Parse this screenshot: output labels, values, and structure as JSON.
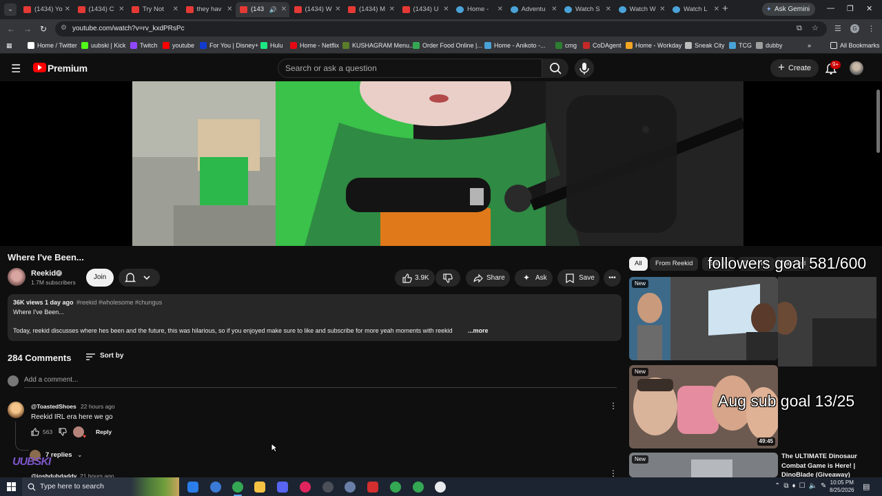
{
  "browser": {
    "tabs": [
      {
        "label": "(1434) Yo",
        "icon": "youtube-icon"
      },
      {
        "label": "(1434) C",
        "icon": "youtube-icon"
      },
      {
        "label": "Try Not",
        "icon": "youtube-icon"
      },
      {
        "label": "they hav",
        "icon": "youtube-icon"
      },
      {
        "label": "(143",
        "icon": "youtube-icon",
        "active": true
      },
      {
        "label": "(1434) W",
        "icon": "youtube-icon"
      },
      {
        "label": "(1434) M",
        "icon": "youtube-icon"
      },
      {
        "label": "(1434) U",
        "icon": "youtube-icon"
      },
      {
        "label": "Home -",
        "icon": "globe-icon"
      },
      {
        "label": "Adventu",
        "icon": "globe-icon"
      },
      {
        "label": "Watch S",
        "icon": "globe-icon"
      },
      {
        "label": "Watch W",
        "icon": "globe-icon"
      },
      {
        "label": "Watch L",
        "icon": "globe-icon"
      }
    ],
    "ask_gemini": "Ask Gemini",
    "url": "youtube.com/watch?v=rv_kxdPRsPc",
    "bookmarks": [
      {
        "label": "Home / Twitter",
        "color": "#ffffff"
      },
      {
        "label": "uubski | Kick",
        "color": "#53fc18"
      },
      {
        "label": "Twitch",
        "color": "#9146ff"
      },
      {
        "label": "youtube",
        "color": "#ff0000"
      },
      {
        "label": "For You | Disney+",
        "color": "#113ccf"
      },
      {
        "label": "Hulu",
        "color": "#1ce783"
      },
      {
        "label": "Home - Netflix",
        "color": "#e50914"
      },
      {
        "label": "KUSHAGRAM Menu...",
        "color": "#5a7d2a"
      },
      {
        "label": "Order Food Online |...",
        "color": "#34a853"
      },
      {
        "label": "Home - Anikoto -...",
        "color": "#4aa3d8"
      },
      {
        "label": "cmg",
        "color": "#2e7d32"
      },
      {
        "label": "CoDAgent",
        "color": "#c62828"
      },
      {
        "label": "Home - Workday",
        "color": "#f5a623"
      },
      {
        "label": "Sneak City",
        "color": "#bdbdbd"
      },
      {
        "label": "TCG",
        "color": "#4aa3d8"
      },
      {
        "label": "dubby",
        "color": "#9e9e9e"
      }
    ],
    "all_bookmarks": "All Bookmarks"
  },
  "youtube": {
    "brand": "Premium",
    "search_placeholder": "Search or ask a question",
    "create_label": "Create",
    "notif_badge": "9+"
  },
  "video": {
    "title": "Where I've Been...",
    "channel": "Reekid",
    "subscribers": "1.7M subscribers",
    "join_label": "Join",
    "likes": "3.9K",
    "share_label": "Share",
    "ask_label": "Ask",
    "save_label": "Save",
    "description": {
      "meta": "36K views  1 day ago",
      "tags": "#reekid #wholesome #chungus",
      "line1": "Where I've Been...",
      "line2": "Today, reekid discusses where hes been and the future, this was hilarious, so if you enjoyed make sure to like and subscribe for more yeah moments with reekid",
      "more": "...more"
    }
  },
  "comments": {
    "count_label": "284 Comments",
    "sort_label": "Sort by",
    "add_placeholder": "Add a comment...",
    "items": [
      {
        "author": "@ToastedShoes",
        "time": "22 hours ago",
        "text": "Reekid IRL era here we go",
        "likes": "563",
        "reply_label": "Reply",
        "replies_label": "7 replies"
      },
      {
        "author": "@joshdubdaddy",
        "time": "21 hours ago"
      }
    ],
    "overlay_logo": "UUBSKI"
  },
  "sidebar": {
    "chips": [
      "All",
      "From Reekid",
      "Related",
      "Recently",
      "Watched"
    ],
    "stream_overlay": {
      "followers": "followers goal 581/600",
      "subs": "Aug sub goal 13/25"
    },
    "videos": [
      {
        "badge": "New"
      },
      {
        "badge": "New",
        "duration": "49:45"
      },
      {
        "badge": "New",
        "title": "The ULTIMATE Dinosaur Combat Game is Here! | DinoBlade (Giveaway)"
      }
    ]
  },
  "taskbar": {
    "search_placeholder": "Type here to search",
    "time": "10:05 PM",
    "date": "8/25/2026"
  }
}
